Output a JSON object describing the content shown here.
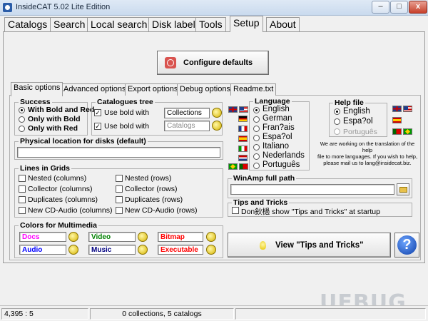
{
  "window": {
    "title": "InsideCAT 5.02 Lite Edition",
    "min_glyph": "–",
    "max_glyph": "□",
    "close_glyph": "x"
  },
  "menu_tabs": [
    "Catalogs",
    "Search",
    "Local search",
    "Disk label",
    "Tools",
    "Setup",
    "About"
  ],
  "active_menu_tab": "Setup",
  "configure_defaults_label": "Configure defaults",
  "sub_tabs": [
    "Basic options",
    "Advanced options",
    "Export options",
    "Debug options",
    "Readme.txt"
  ],
  "active_sub_tab": "Basic options",
  "success": {
    "title": "Success",
    "options": [
      "With Bold and Red",
      "Only with Bold",
      "Only with Red"
    ],
    "selected": "With Bold and Red"
  },
  "catalogues_tree": {
    "title": "Catalogues tree",
    "rows": [
      {
        "label": "Use bold with",
        "checked": true,
        "value": "Collections",
        "enabled": true
      },
      {
        "label": "Use bold with",
        "checked": true,
        "value": "Catalogs",
        "enabled": false
      }
    ]
  },
  "physical_location": {
    "title": "Physical location for disks (default)",
    "value": ""
  },
  "lines_in_grids": {
    "title": "Lines in Grids",
    "left": [
      "Nested (columns)",
      "Collector (columns)",
      "Duplicates (columns)",
      "New CD-Audio (columns)"
    ],
    "right": [
      "Nested (rows)",
      "Collector (rows)",
      "Duplicates (rows)",
      "New CD-Audio (rows)"
    ]
  },
  "colors_multimedia": {
    "title": "Colors for Multimedia",
    "items": [
      {
        "label": "Docs",
        "color": "#ff00ff"
      },
      {
        "label": "Video",
        "color": "#008000"
      },
      {
        "label": "Bitmap",
        "color": "#ff0000"
      },
      {
        "label": "Audio",
        "color": "#0000ff"
      },
      {
        "label": "Music",
        "color": "#000080"
      },
      {
        "label": "Executable",
        "color": "#ff0000"
      }
    ]
  },
  "language": {
    "title": "Language",
    "options": [
      "English",
      "German",
      "Fran?ais",
      "Espa?ol",
      "Italiano",
      "Nederlands",
      "Português"
    ],
    "selected": "English"
  },
  "help_file": {
    "title": "Help file",
    "options": [
      "English",
      "Espa?ol",
      "Português"
    ],
    "selected": "English",
    "disabled": [
      "Português"
    ]
  },
  "translation_note": [
    "We are working on the translation of the help",
    "file to more languages. If you wish to help,",
    "please mail us to lang@insidecat.biz."
  ],
  "winamp": {
    "title": "WinAmp full path",
    "value": ""
  },
  "tips_and_tricks": {
    "title": "Tips and Tricks",
    "checkbox_label": "Don鈥檛 show \"Tips and Tricks\" at startup",
    "checked": false
  },
  "view_tips_label": "View \"Tips and Tricks\"",
  "help_label": "?",
  "status": {
    "position": "4,395 : 5",
    "summary": "0 collections, 5 catalogs"
  },
  "watermark": "UEBUG"
}
